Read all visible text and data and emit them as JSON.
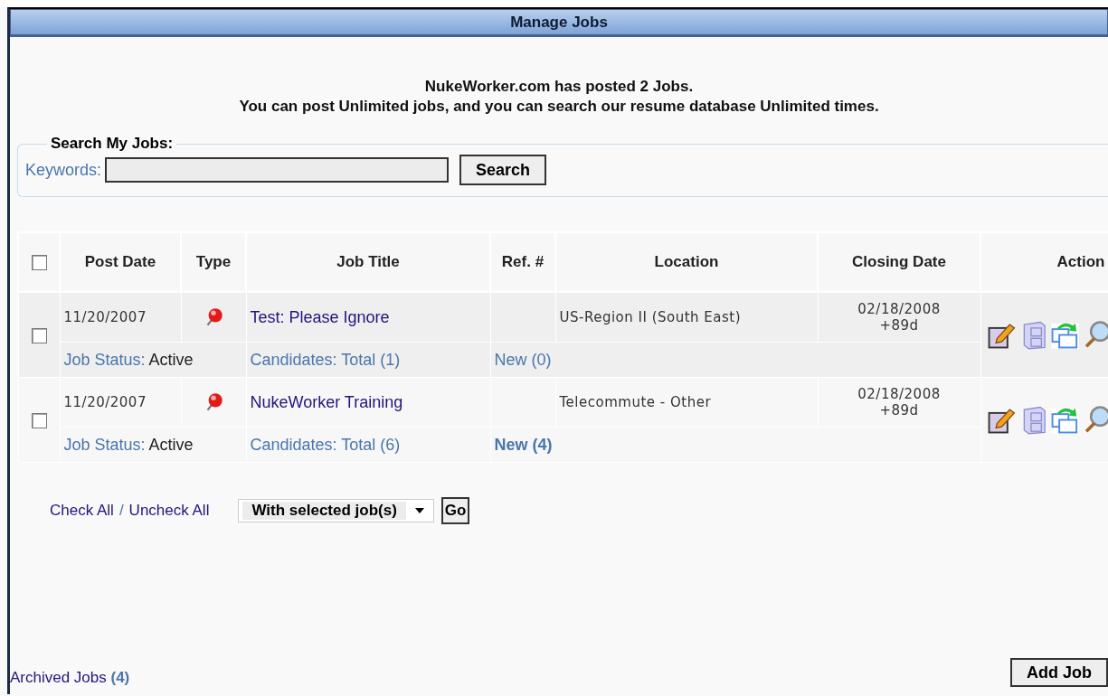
{
  "panel": {
    "title": "Manage Jobs"
  },
  "intro": [
    "NukeWorker.com has posted 2 Jobs.",
    "You can post Unlimited jobs, and you can search our resume database Unlimited times."
  ],
  "search": {
    "legend": "Search My Jobs:",
    "label": "Keywords:",
    "button": "Search"
  },
  "table": {
    "select_all_checked": false,
    "columns": [
      "Post Date",
      "Type",
      "Job Title",
      "Ref. #",
      "Location",
      "Closing Date",
      "Action"
    ],
    "rows": [
      {
        "checked": false,
        "post_date": "11/20/2007",
        "title": "Test: Please Ignore",
        "location": "US-Region II (South East)",
        "closing_date": "02/18/2008",
        "closing_offset": "+89d",
        "status_label": "Job Status:",
        "status": "Active",
        "candidates": "Candidates: Total (1)",
        "new": "New (0)",
        "new_highlight": false
      },
      {
        "checked": false,
        "post_date": "11/20/2007",
        "title": "NukeWorker Training",
        "location": "Telecommute - Other",
        "closing_date": "02/18/2008",
        "closing_offset": "+89d",
        "status_label": "Job Status:",
        "status": "Active",
        "candidates": "Candidates: Total (6)",
        "new": "New (4)",
        "new_highlight": true
      }
    ]
  },
  "bulk": {
    "check_all": "Check All",
    "separator": "/",
    "uncheck_all": "Uncheck All",
    "action_select": "With selected job(s)",
    "go": "Go"
  },
  "archived": {
    "label": "Archived Jobs",
    "count": "(4)"
  },
  "add_button": "Add Job"
}
